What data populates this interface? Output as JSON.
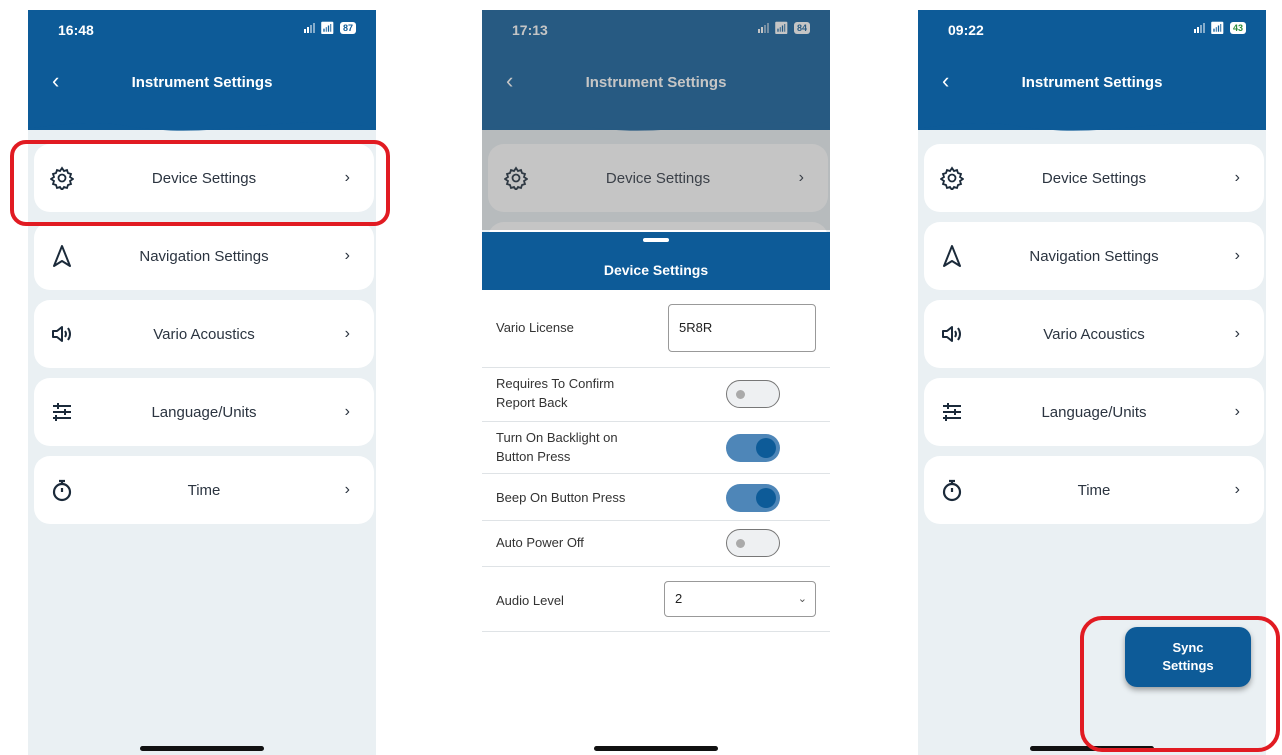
{
  "screens": [
    {
      "time": "16:48",
      "battery": "87",
      "title": "Instrument Settings",
      "menu": [
        {
          "label": "Device Settings",
          "icon": "gear-icon"
        },
        {
          "label": "Navigation Settings",
          "icon": "navigation-arrow-icon"
        },
        {
          "label": "Vario Acoustics",
          "icon": "speaker-icon"
        },
        {
          "label": "Language/Units",
          "icon": "sliders-icon"
        },
        {
          "label": "Time",
          "icon": "stopwatch-icon"
        }
      ]
    },
    {
      "time": "17:13",
      "battery": "84",
      "title": "Instrument Settings",
      "menu_visible": {
        "label": "Device Settings",
        "icon": "gear-icon"
      },
      "sheet": {
        "title": "Device Settings",
        "vario_license_label": "Vario License",
        "vario_license_value": "5R8R",
        "toggles": [
          {
            "label_line1": "Requires To Confirm",
            "label_line2": "Report Back",
            "on": false
          },
          {
            "label_line1": "Turn On Backlight on",
            "label_line2": "Button Press",
            "on": true
          },
          {
            "label_line1": "Beep On Button Press",
            "label_line2": "",
            "on": true
          },
          {
            "label_line1": "Auto Power Off",
            "label_line2": "",
            "on": false
          }
        ],
        "audio_level_label": "Audio Level",
        "audio_level_value": "2"
      }
    },
    {
      "time": "09:22",
      "battery": "43",
      "title": "Instrument Settings",
      "menu": [
        {
          "label": "Device Settings",
          "icon": "gear-icon"
        },
        {
          "label": "Navigation Settings",
          "icon": "navigation-arrow-icon"
        },
        {
          "label": "Vario Acoustics",
          "icon": "speaker-icon"
        },
        {
          "label": "Language/Units",
          "icon": "sliders-icon"
        },
        {
          "label": "Time",
          "icon": "stopwatch-icon"
        }
      ],
      "sync_button": {
        "line1": "Sync",
        "line2": "Settings"
      }
    }
  ],
  "colors": {
    "brand": "#0d5b98",
    "highlight": "#e11b22",
    "background": "#eaf0f3"
  }
}
